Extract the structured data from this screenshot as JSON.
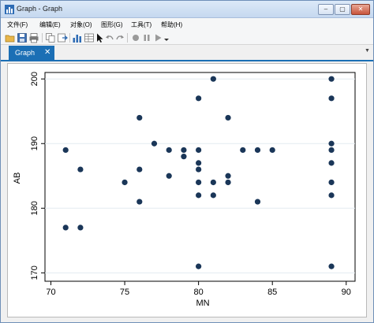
{
  "window": {
    "title": "Graph - Graph"
  },
  "menu": {
    "items": [
      {
        "label": "文件(F)"
      },
      {
        "label": "编辑(E)"
      },
      {
        "label": "对象(O)"
      },
      {
        "label": "图形(G)"
      },
      {
        "label": "工具(T)"
      },
      {
        "label": "帮助(H)"
      }
    ]
  },
  "toolbar": {
    "icons": [
      "open-icon",
      "save-icon",
      "print-icon",
      "copy-icon",
      "export-icon",
      "graph-editor-icon",
      "data-table-icon",
      "pointer-icon",
      "undo-icon",
      "redo-icon",
      "record-icon",
      "pause-icon",
      "play-icon",
      "dropdown-icon"
    ]
  },
  "tab": {
    "label": "Graph",
    "close_glyph": "✕"
  },
  "chart_data": {
    "type": "scatter",
    "xlabel": "MN",
    "ylabel": "AB",
    "xlim": [
      70,
      90
    ],
    "ylim": [
      170,
      200
    ],
    "xticks": [
      70,
      75,
      80,
      85,
      90
    ],
    "yticks": [
      170,
      180,
      190,
      200
    ],
    "grid": "horizontal",
    "marker_color": "#1a3658",
    "points": [
      [
        71,
        177
      ],
      [
        71,
        189
      ],
      [
        72,
        177
      ],
      [
        72,
        186
      ],
      [
        75,
        184
      ],
      [
        76,
        181
      ],
      [
        76,
        186
      ],
      [
        76,
        194
      ],
      [
        77,
        190
      ],
      [
        78,
        185
      ],
      [
        78,
        189
      ],
      [
        79,
        188
      ],
      [
        79,
        189
      ],
      [
        80,
        171
      ],
      [
        80,
        182
      ],
      [
        80,
        184
      ],
      [
        80,
        186
      ],
      [
        80,
        187
      ],
      [
        80,
        189
      ],
      [
        80,
        197
      ],
      [
        81,
        182
      ],
      [
        81,
        184
      ],
      [
        81,
        200
      ],
      [
        82,
        184
      ],
      [
        82,
        185
      ],
      [
        82,
        194
      ],
      [
        83,
        189
      ],
      [
        84,
        181
      ],
      [
        84,
        189
      ],
      [
        85,
        189
      ],
      [
        89,
        171
      ],
      [
        89,
        182
      ],
      [
        89,
        184
      ],
      [
        89,
        187
      ],
      [
        89,
        189
      ],
      [
        89,
        190
      ],
      [
        89,
        197
      ],
      [
        89,
        200
      ]
    ]
  }
}
